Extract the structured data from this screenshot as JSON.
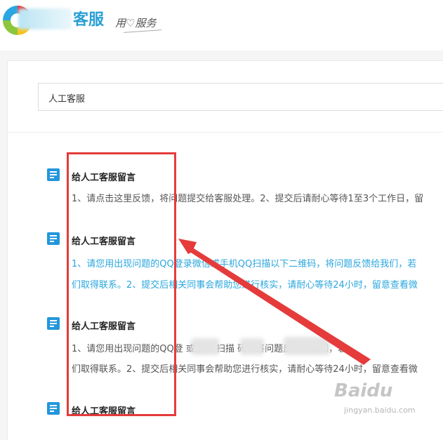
{
  "header": {
    "brand_name": "客服",
    "slogan": "用♡服务"
  },
  "search": {
    "value": "人工客服"
  },
  "results": [
    {
      "title": "给人工客服留言",
      "desc_lines": [
        "1、请点击这里反馈，将问题提交给客服处理。2、提交后请耐心等待1至3个工作日，留"
      ],
      "highlight": false
    },
    {
      "title": "给人工客服留言",
      "desc_lines": [
        "1、请您用出现问题的QQ登录微信或手机QQ扫描以下二维码，将问题反馈给我们，若",
        "们取得联系。2、提交后相关同事会帮助您进行核实，请耐心等待24小时，留意查看微"
      ],
      "highlight": true
    },
    {
      "title": "给人工客服留言",
      "desc_lines": [
        "1、请您用出现问题的QQ登        或手机       扫描               码，将问题反馈给我们，若",
        "们取得联系。2、提交后相关同事会帮助您进行核实，请耐心等待24小时，留意查看微"
      ],
      "highlight": false
    },
    {
      "title": "给人工客服留言",
      "desc_lines": [],
      "highlight": false
    }
  ],
  "watermark": {
    "text": "Baidu",
    "sub": "jingyan.baidu.com"
  },
  "colors": {
    "accent": "#2396dc",
    "link_blue": "#2aa6dd",
    "annotation_red": "#e53b3b"
  }
}
